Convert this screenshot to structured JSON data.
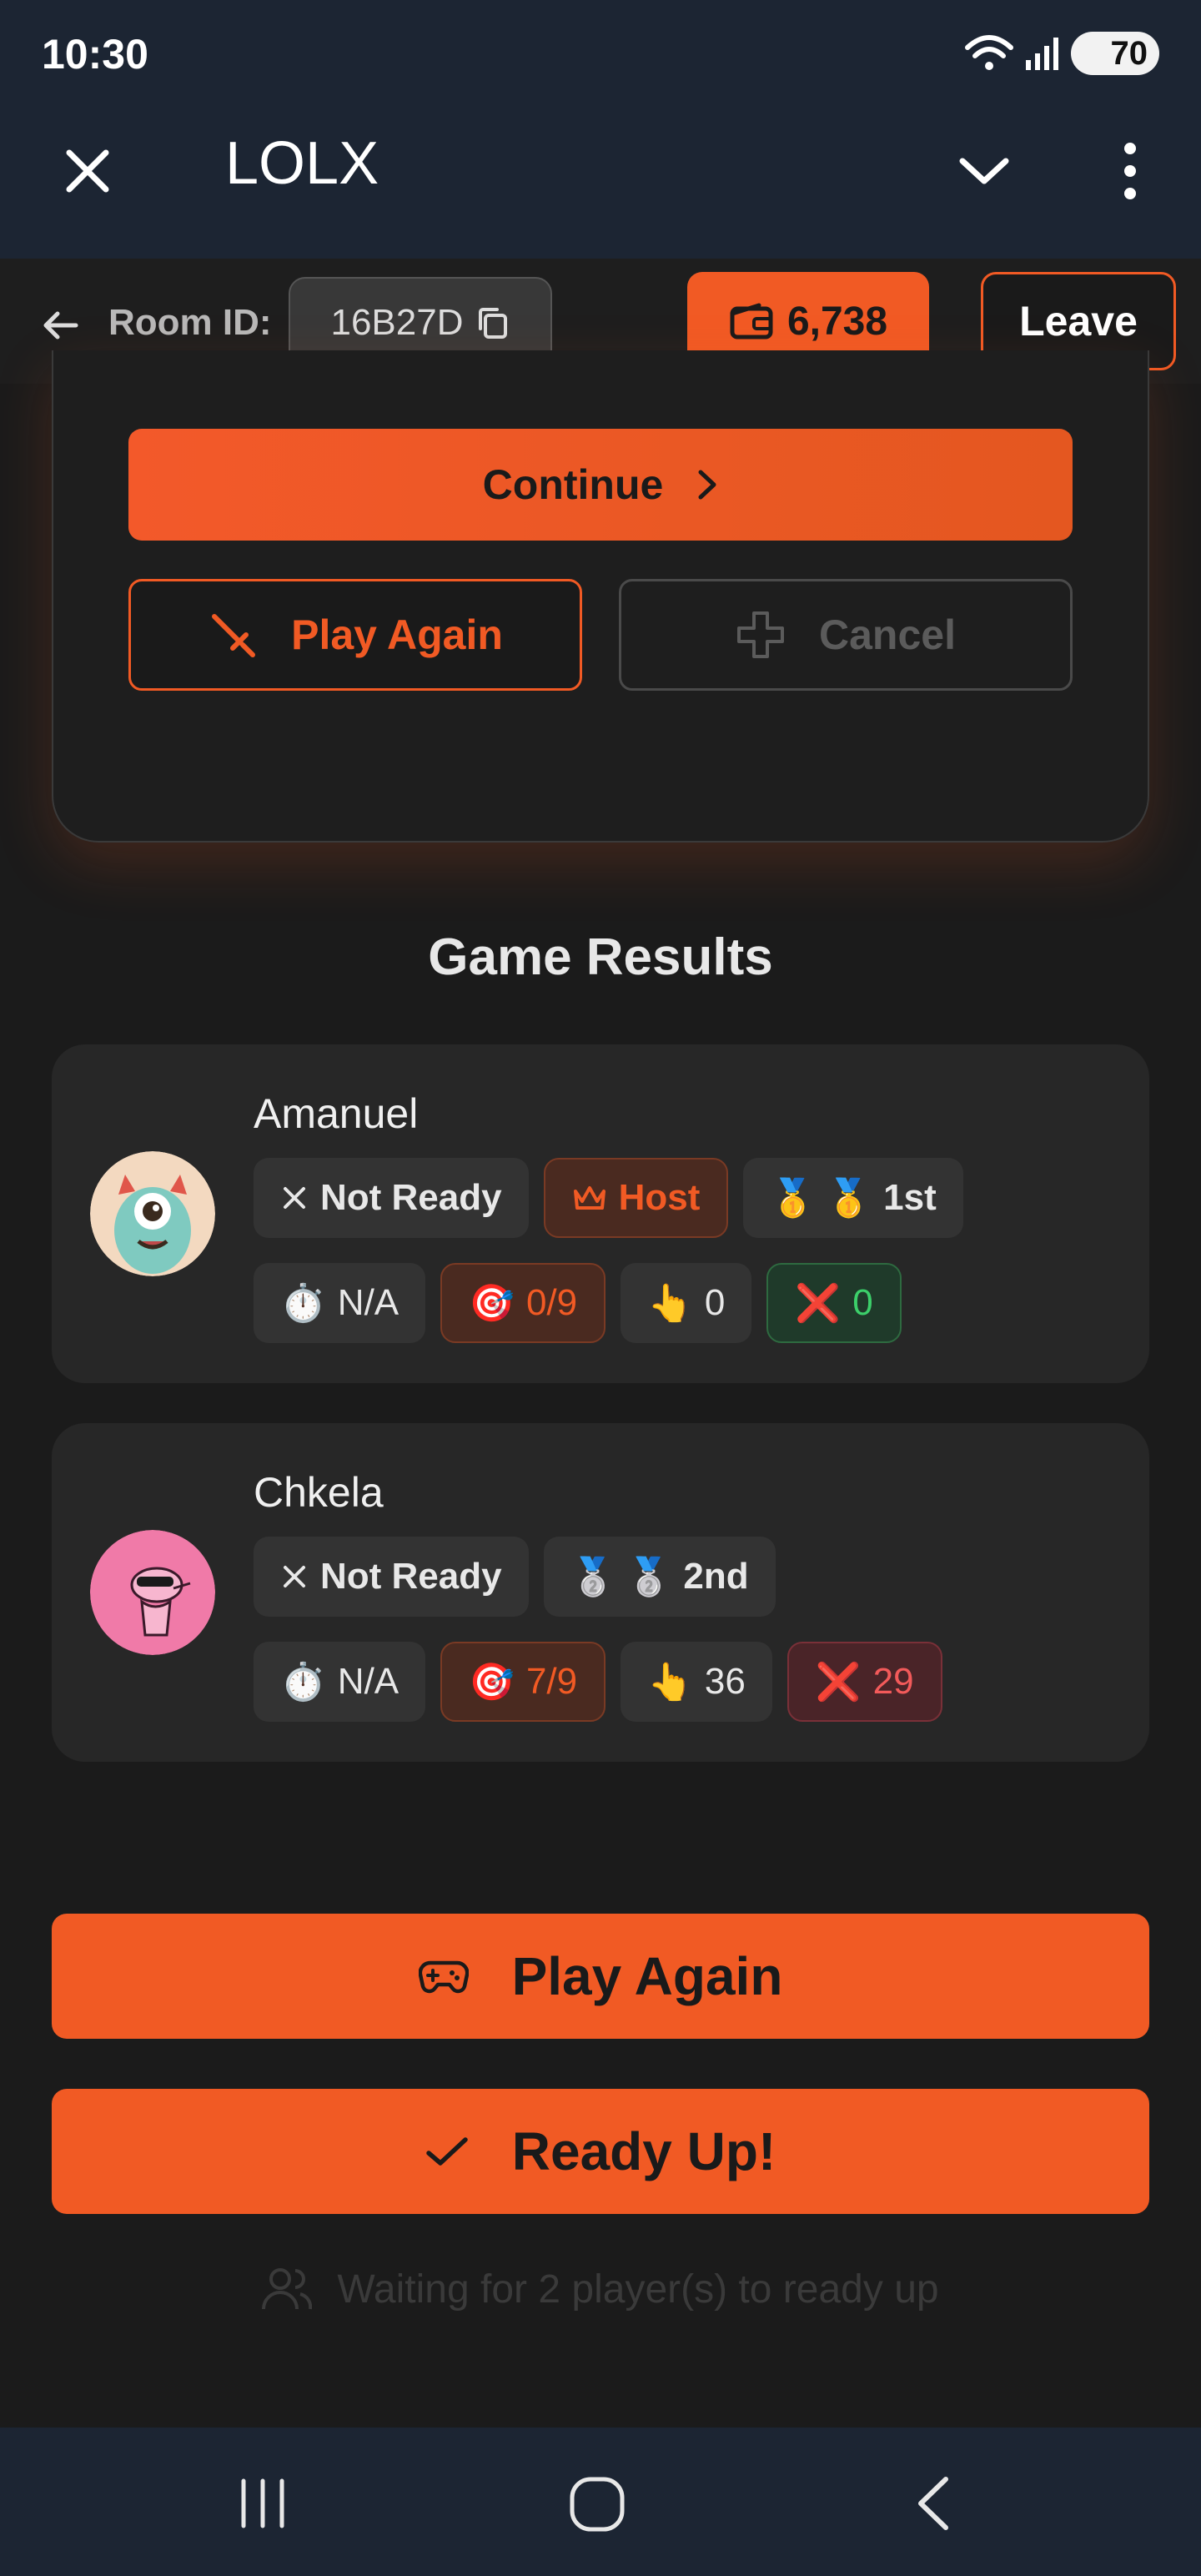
{
  "status_bar": {
    "time": "10:30",
    "battery": "70"
  },
  "app_bar": {
    "title": "LOLX"
  },
  "room_bar": {
    "room_label": "Room ID:",
    "room_id": "16B27D",
    "balance": "6,738",
    "leave_label": "Leave"
  },
  "top_card": {
    "continue_label": "Continue",
    "play_again_label": "Play Again",
    "cancel_label": "Cancel"
  },
  "results_title": "Game Results",
  "players": [
    {
      "name": "Amanuel",
      "status": "Not Ready",
      "role": "Host",
      "rank": "1st",
      "rank_icon": "🥇 🥇",
      "time": "N/A",
      "score": "0/9",
      "taps": "0",
      "misses": "0"
    },
    {
      "name": "Chkela",
      "status": "Not Ready",
      "rank": "2nd",
      "rank_icon": "🥈 🥈",
      "time": "N/A",
      "score": "7/9",
      "taps": "36",
      "misses": "29"
    }
  ],
  "bottom": {
    "play_again_label": "Play Again",
    "ready_label": "Ready Up!",
    "waiting_text": "Waiting for 2 player(s) to ready up"
  },
  "colors": {
    "accent": "#f15a24",
    "background": "#1b1b1b",
    "card": "#272727",
    "system_bar": "#1c2533"
  }
}
